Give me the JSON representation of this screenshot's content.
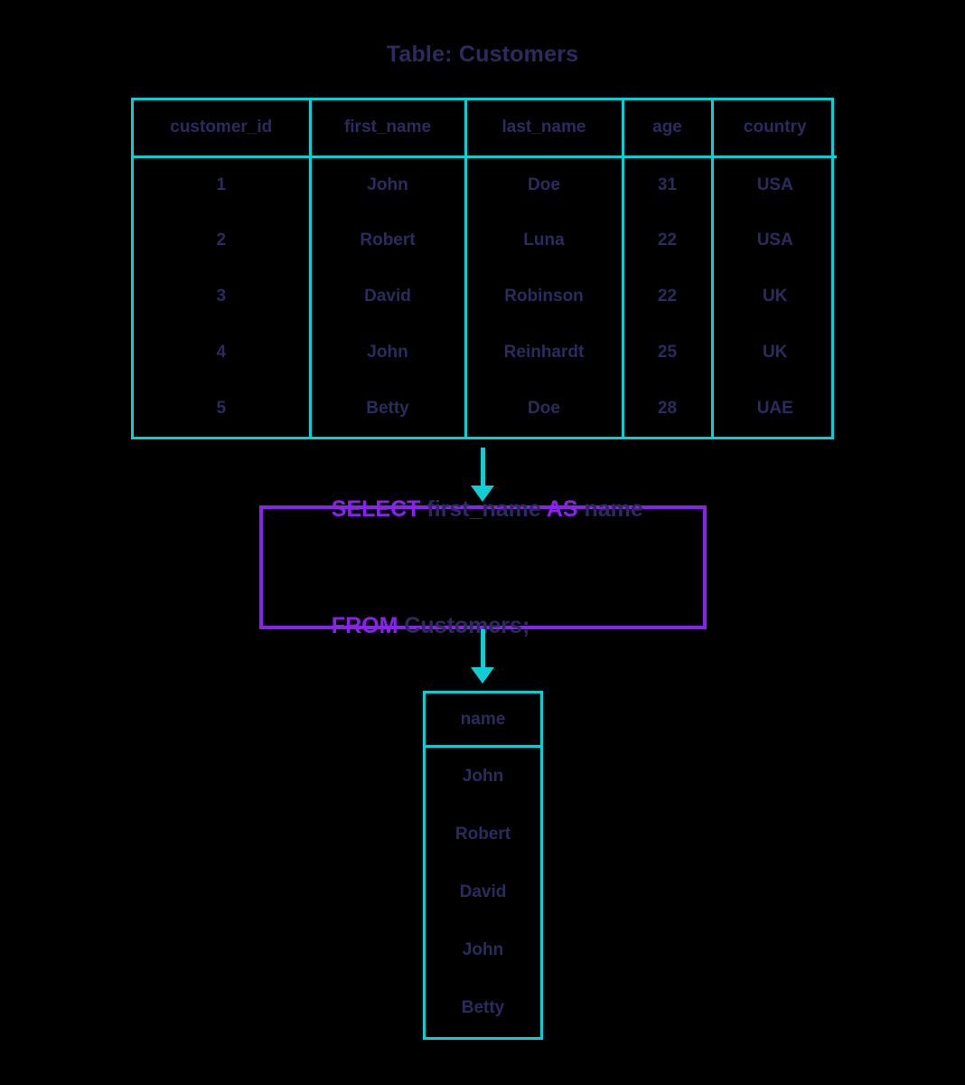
{
  "title": "Table: Customers",
  "colors": {
    "table_border": "#00d2d8",
    "arrow": "#11cdd4",
    "query_border": "#8a22ee",
    "keyword": "#8a22ee",
    "text": "#2b2b5e",
    "background": "#000000"
  },
  "source_table": {
    "name": "Customers",
    "columns": [
      "customer_id",
      "first_name",
      "last_name",
      "age",
      "country"
    ],
    "rows": [
      [
        "1",
        "John",
        "Doe",
        "31",
        "USA"
      ],
      [
        "2",
        "Robert",
        "Luna",
        "22",
        "USA"
      ],
      [
        "3",
        "David",
        "Robinson",
        "22",
        "UK"
      ],
      [
        "4",
        "John",
        "Reinhardt",
        "25",
        "UK"
      ],
      [
        "5",
        "Betty",
        "Doe",
        "28",
        "UAE"
      ]
    ]
  },
  "query": {
    "full_text": "SELECT first_name AS name FROM Customers;",
    "line1": [
      {
        "text": "SELECT",
        "type": "keyword"
      },
      {
        "text": " first_name ",
        "type": "identifier"
      },
      {
        "text": "AS",
        "type": "keyword"
      },
      {
        "text": " name",
        "type": "identifier"
      }
    ],
    "line2": [
      {
        "text": "FROM",
        "type": "keyword"
      },
      {
        "text": " Customers;",
        "type": "identifier"
      }
    ]
  },
  "result_table": {
    "columns": [
      "name"
    ],
    "rows": [
      [
        "John"
      ],
      [
        "Robert"
      ],
      [
        "David"
      ],
      [
        "John"
      ],
      [
        "Betty"
      ]
    ]
  },
  "arrows": [
    {
      "name": "table-to-query",
      "direction": "down"
    },
    {
      "name": "query-to-result",
      "direction": "down"
    }
  ]
}
